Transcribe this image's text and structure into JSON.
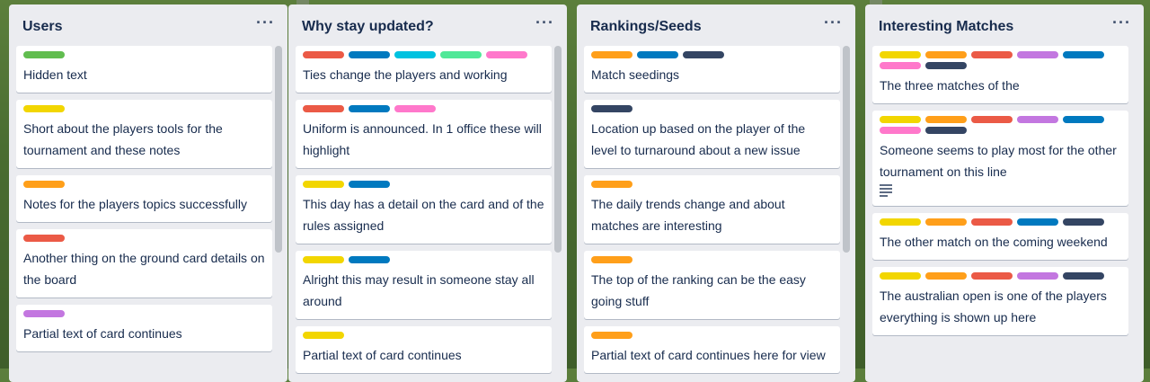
{
  "colors": {
    "green": "#61bd4f",
    "yellow": "#f2d600",
    "orange": "#ff9f1a",
    "red": "#eb5a46",
    "purple": "#c377e0",
    "blue": "#0079bf",
    "sky": "#00c2e0",
    "lime": "#51e898",
    "pink": "#ff78cb",
    "navy": "#344563"
  },
  "lists": [
    {
      "title": "Users",
      "menu": "···",
      "cards": [
        {
          "labels": [
            "green"
          ],
          "text": "Hidden text"
        },
        {
          "labels": [
            "yellow"
          ],
          "text": "Short about the players tools for the tournament and these notes"
        },
        {
          "labels": [
            "orange"
          ],
          "text": "Notes for the players topics successfully"
        },
        {
          "labels": [
            "red"
          ],
          "text": "Another thing on the ground card details on the board"
        },
        {
          "labels": [
            "purple"
          ],
          "text": "Partial text of card continues"
        }
      ]
    },
    {
      "title": "Why stay updated?",
      "menu": "···",
      "cards": [
        {
          "labels": [
            "red",
            "blue",
            "sky",
            "lime",
            "pink"
          ],
          "text": "Ties change the players and working"
        },
        {
          "labels": [
            "red",
            "blue",
            "pink"
          ],
          "text": "Uniform is announced. In 1 office these will highlight"
        },
        {
          "labels": [
            "yellow",
            "blue"
          ],
          "text": "This day has a detail on the card and of the rules assigned"
        },
        {
          "labels": [
            "yellow",
            "blue"
          ],
          "text": "Alright this may result in someone stay all around"
        },
        {
          "labels": [
            "yellow"
          ],
          "text": "Partial text of card continues"
        }
      ]
    },
    {
      "title": "Rankings/Seeds",
      "menu": "···",
      "cards": [
        {
          "labels": [
            "orange",
            "blue",
            "navy"
          ],
          "text": "Match seedings"
        },
        {
          "labels": [
            "navy"
          ],
          "text": "Location up based on the player of the level to turnaround about a new issue"
        },
        {
          "labels": [
            "orange"
          ],
          "text": "The daily trends change and about matches are interesting"
        },
        {
          "labels": [
            "orange"
          ],
          "text": "The top of the ranking can be the easy going stuff"
        },
        {
          "labels": [
            "orange"
          ],
          "text": "Partial text of card continues here for view"
        }
      ]
    },
    {
      "title": "Interesting Matches",
      "menu": "···",
      "cards": [
        {
          "labels": [
            "yellow",
            "orange",
            "red",
            "purple",
            "blue",
            "pink",
            "navy"
          ],
          "text": "The three matches of the"
        },
        {
          "labels": [
            "yellow",
            "orange",
            "red",
            "purple",
            "blue",
            "pink",
            "navy"
          ],
          "text": "Someone seems to play most for the other tournament on this line",
          "has_description": true
        },
        {
          "labels": [
            "yellow",
            "orange",
            "red",
            "blue",
            "navy"
          ],
          "text": "The other match on the coming weekend"
        },
        {
          "labels": [
            "yellow",
            "orange",
            "red",
            "purple",
            "navy"
          ],
          "text": "The australian open is one of the players everything is shown up here"
        }
      ]
    }
  ]
}
